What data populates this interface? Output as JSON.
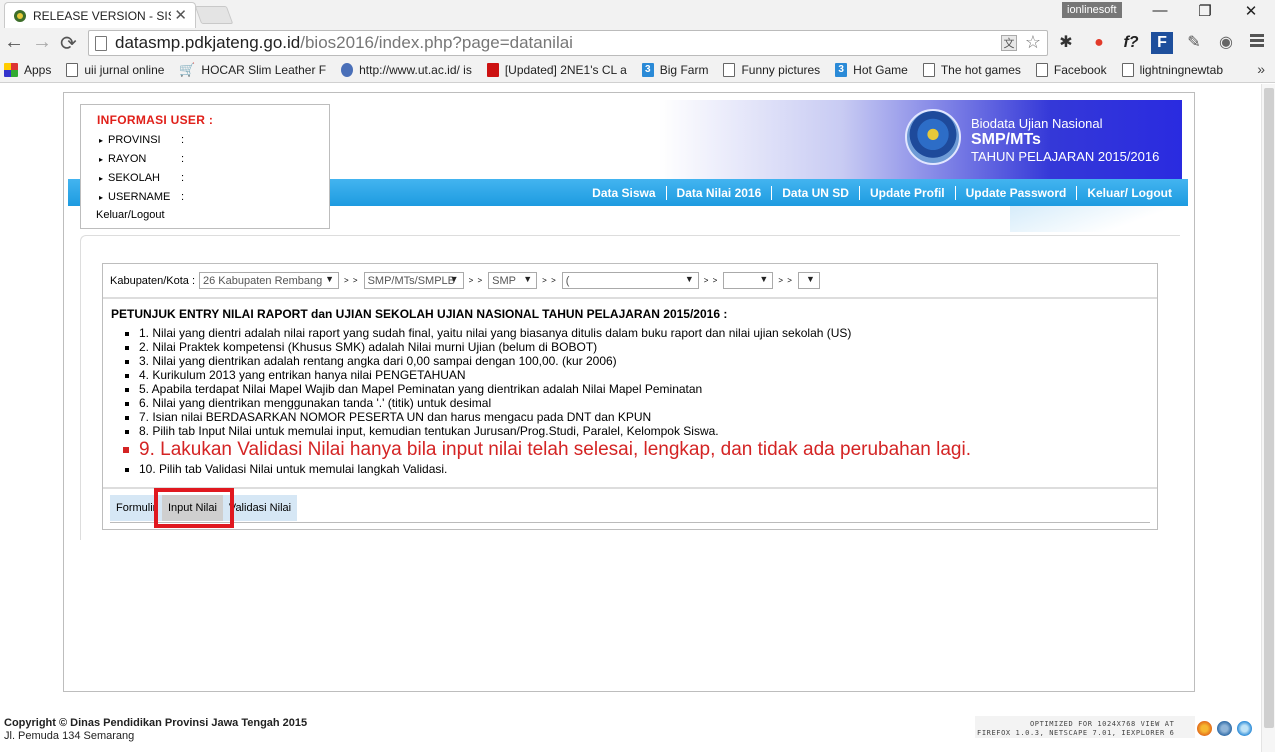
{
  "browser": {
    "tab_title": "RELEASE VERSION - SISTE",
    "tab_close": "✕",
    "user_badge": "ionlinesoft",
    "win_min": "—",
    "win_max": "❐",
    "win_close": "✕",
    "url_host": "datasmp.pdkjateng.go.id",
    "url_path": "/bios2016/index.php?page=datanilai",
    "back": "←",
    "forward": "→",
    "reload": "⟳",
    "translate": "文",
    "star": "☆",
    "ext_icons": [
      "bug-icon",
      "record-icon",
      "f-script-icon",
      "f-brand-icon",
      "dropper-icon",
      "globe-icon"
    ],
    "ext_glyphs": [
      "✱",
      "●",
      "f?",
      "F",
      "✎",
      "◉"
    ],
    "bookmarks": [
      {
        "label": "Apps",
        "icon": "apps"
      },
      {
        "label": "uii jurnal online",
        "icon": "page"
      },
      {
        "label": "HOCAR Slim Leather F",
        "icon": "cart"
      },
      {
        "label": "http://www.ut.ac.id/ is",
        "icon": "person"
      },
      {
        "label": "[Updated] 2NE1's CL a",
        "icon": "red"
      },
      {
        "label": "Big Farm",
        "icon": "blue"
      },
      {
        "label": "Funny pictures",
        "icon": "page"
      },
      {
        "label": "Hot Game",
        "icon": "blue"
      },
      {
        "label": "The hot games",
        "icon": "page"
      },
      {
        "label": "Facebook",
        "icon": "page"
      },
      {
        "label": "lightningnewtab",
        "icon": "page"
      }
    ],
    "bookmarks_more": "»"
  },
  "header": {
    "line1": "Biodata Ujian Nasional",
    "line2": "SMP/MTs",
    "line3": "TAHUN PELAJARAN 2015/2016"
  },
  "nav": [
    "Data Siswa",
    "Data Nilai 2016",
    "Data UN SD",
    "Update Profil",
    "Update Password",
    "Keluar/ Logout"
  ],
  "userbox": {
    "title": "INFORMASI USER :",
    "rows": [
      {
        "label": "PROVINSI",
        "colon": ":"
      },
      {
        "label": "RAYON",
        "colon": ":"
      },
      {
        "label": "SEKOLAH",
        "colon": ":"
      },
      {
        "label": "USERNAME",
        "colon": ":"
      }
    ],
    "logout": "Keluar/Logout"
  },
  "filters": {
    "label": "Kabupaten/Kota :",
    "kabupaten": "26 Kabupaten Rembang",
    "jenjang": "SMP/MTs/SMPLB",
    "jenis": "SMP",
    "sekolah": "(",
    "f5": "",
    "f6": "",
    "separator": "> >"
  },
  "instructions": {
    "title": "PETUNJUK ENTRY NILAI RAPORT dan UJIAN SEKOLAH UJIAN NASIONAL TAHUN PELAJARAN 2015/2016 :",
    "items": [
      "1. Nilai yang dientri adalah nilai raport yang sudah final, yaitu nilai yang biasanya ditulis dalam buku raport dan nilai ujian sekolah (US)",
      "2. Nilai Praktek kompetensi (Khusus SMK) adalah Nilai murni Ujian (belum di BOBOT)",
      "3. Nilai yang dientrikan adalah rentang angka dari 0,00 sampai dengan 100,00. (kur 2006)",
      "4. Kurikulum 2013 yang entrikan hanya nilai PENGETAHUAN",
      "5. Apabila terdapat Nilai Mapel Wajib dan Mapel Peminatan yang dientrikan adalah Nilai Mapel Peminatan",
      "6. Nilai yang dientrikan menggunakan tanda '.' (titik) untuk desimal",
      "7. Isian nilai BERDASARKAN NOMOR PESERTA UN dan harus mengacu pada DNT dan KPUN",
      "8. Pilih tab Input Nilai untuk memulai input, kemudian tentukan Jurusan/Prog.Studi, Paralel, Kelompok Siswa.",
      "9. Lakukan Validasi Nilai hanya bila input nilai telah selesai, lengkap, dan tidak ada perubahan lagi.",
      "10. Pilih tab Validasi Nilai untuk memulai langkah Validasi."
    ],
    "highlight_index": 8
  },
  "tabs": [
    "Formulir",
    "Input Nilai",
    "Validasi Nilai"
  ],
  "footer": {
    "copyright": "Copyright © Dinas Pendidikan Provinsi Jawa Tengah 2015",
    "address": "Jl. Pemuda 134 Semarang",
    "optimized_1": "OPTIMIZED FOR 1024X768 VIEW AT",
    "optimized_2": "FIREFOX 1.0.3, NETSCAPE 7.01, IEXPLORER 6"
  },
  "colors": {
    "accent_red": "#e0181f",
    "nav_blue": "#1d9be0",
    "banner_blue": "#2a2be0"
  }
}
